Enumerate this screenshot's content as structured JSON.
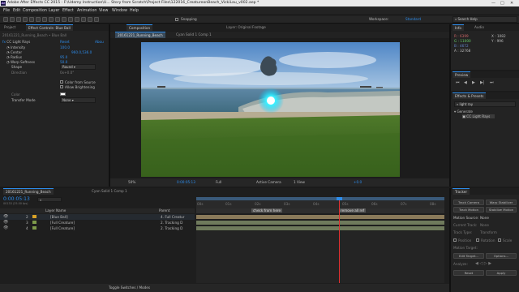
{
  "titlebar": {
    "logo": "Ae",
    "title": "Adobe After Effects CC 2015 - F:\\Udemy Instruction\\U... Story from Scratch\\Project Files\\122016_CreatureonBeach_VickiLau_v002.aep *",
    "min": "—",
    "max": "□",
    "close": "✕"
  },
  "menu": [
    "File",
    "Edit",
    "Composition",
    "Layer",
    "Effect",
    "Animation",
    "View",
    "Window",
    "Help"
  ],
  "toolbar": {
    "snapping": "Snapping",
    "workspace_label": "Workspace:",
    "workspace_value": "Standard",
    "search_help": "Search Help"
  },
  "effect_controls": {
    "tabs": [
      "Project",
      "Effect Controls: Blue Ball"
    ],
    "header": "20161221_Running_Beach • Blue Ball",
    "effect_name": "CC Light Rays",
    "reset": "Reset",
    "about": "Abou",
    "params": [
      {
        "name": "Intensity",
        "value": "100.0"
      },
      {
        "name": "Center",
        "value": "960.0,536.0"
      },
      {
        "name": "Radius",
        "value": "95.0"
      },
      {
        "name": "Warp Softness",
        "value": "50.0"
      },
      {
        "name": "Shape",
        "value": "Round"
      },
      {
        "name": "Direction",
        "value": "0x+0.0°"
      },
      {
        "name": "",
        "value": "Color from Source"
      },
      {
        "name": "",
        "value": "Allow Brightening"
      },
      {
        "name": "Color",
        "value": ""
      },
      {
        "name": "Transfer Mode",
        "value": "None"
      }
    ]
  },
  "composition": {
    "panel_tab": "Composition",
    "layer_tab": "Layer: Original Footage",
    "comp_tabs": [
      "20161221_Running_Beach",
      "Cyan Solid 1 Comp 1"
    ],
    "footer": {
      "zoom": "50%",
      "timecode": "0:00:05:13",
      "resolution": "Full",
      "camera": "Active Camera",
      "view": "1 View",
      "exposure": "+0.0"
    }
  },
  "info": {
    "tabs": [
      "Info",
      "Audio"
    ],
    "rgba": [
      {
        "k": "R",
        "v": "6399"
      },
      {
        "k": "G",
        "v": "11000"
      },
      {
        "k": "B",
        "v": "4672"
      },
      {
        "k": "A",
        "v": "32768"
      }
    ],
    "xy": [
      {
        "k": "X",
        "v": "1082"
      },
      {
        "k": "Y",
        "v": "996"
      }
    ]
  },
  "preview": {
    "title": "Preview"
  },
  "effects_presets": {
    "title": "Effects & Presets",
    "search": "light ray",
    "category": "Generate",
    "item": "CC Light Rays"
  },
  "timeline": {
    "tabs": [
      "20161221_Running_Beach",
      "Cyan Solid 1 Comp 1"
    ],
    "timecode": "0:00:05:13",
    "fps": "00133 (25.00 fps)",
    "col_layer_name": "Layer Name",
    "col_parent": "Parent",
    "layers": [
      {
        "num": "2",
        "name": "[Blue Ball]",
        "parent": "4. Full Creatur"
      },
      {
        "num": "3",
        "name": "[Full Creature]",
        "parent": "2. Tracking D"
      },
      {
        "num": "4",
        "name": "[Full Creature]",
        "parent": "2. Tracking D"
      }
    ],
    "markers": [
      "check from here",
      "remove all ref"
    ],
    "ruler": [
      "00s",
      "01s",
      "02s",
      "03s",
      "04s",
      "05s",
      "06s",
      "07s",
      "08s"
    ],
    "footer": "Toggle Switches / Modes"
  },
  "tracker": {
    "title": "Tracker",
    "buttons": [
      "Track Camera",
      "Warp Stabilizer",
      "Track Motion",
      "Stabilize Motion"
    ],
    "motion_source_label": "Motion Source:",
    "motion_source_value": "None",
    "current_track_label": "Current Track:",
    "current_track_value": "None",
    "track_type_label": "Track Type:",
    "track_type_value": "Transform",
    "position": "Position",
    "rotation": "Rotation",
    "scale": "Scale",
    "motion_target": "Motion Target:",
    "edit_target": "Edit Target...",
    "options": "Options...",
    "analyze": "Analyze:",
    "reset": "Reset",
    "apply": "Apply"
  }
}
